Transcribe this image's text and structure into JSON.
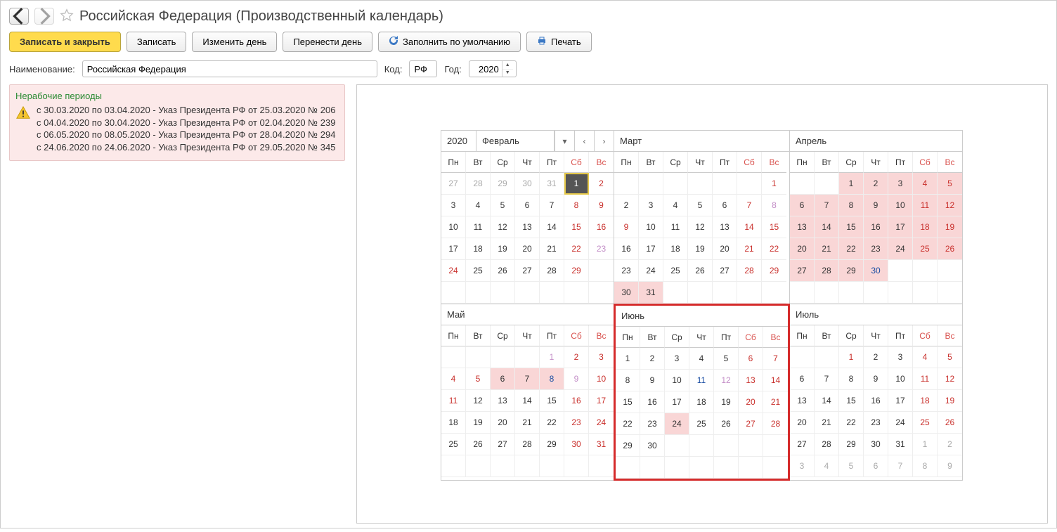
{
  "title": "Российская Федерация (Производственный календарь)",
  "toolbar": {
    "saveClose": "Записать и закрыть",
    "save": "Записать",
    "changeDay": "Изменить день",
    "moveDay": "Перенести день",
    "fillDefault": "Заполнить по умолчанию",
    "print": "Печать"
  },
  "form": {
    "nameLabel": "Наименование:",
    "nameValue": "Российская Федерация",
    "codeLabel": "Код:",
    "codeValue": "РФ",
    "yearLabel": "Год:",
    "yearValue": "2020"
  },
  "warning": {
    "title": "Нерабочие периоды",
    "items": [
      "с 30.03.2020 по 03.04.2020 - Указ Президента РФ от 25.03.2020 № 206",
      "с 04.04.2020 по 30.04.2020 - Указ Президента РФ от 02.04.2020 № 239",
      "с 06.05.2020 по 08.05.2020 - Указ Президента РФ от 28.04.2020 № 294",
      "с 24.06.2020 по 24.06.2020 - Указ Президента РФ от 29.05.2020 № 345"
    ]
  },
  "calendar": {
    "year": "2020",
    "dow": [
      "Пн",
      "Вт",
      "Ср",
      "Чт",
      "Пт",
      "Сб",
      "Вс"
    ],
    "months": [
      {
        "name": "Февраль",
        "hasYear": true,
        "hasNav": true,
        "weeks": [
          [
            {
              "n": "27",
              "cls": "muted"
            },
            {
              "n": "28",
              "cls": "muted"
            },
            {
              "n": "29",
              "cls": "muted"
            },
            {
              "n": "30",
              "cls": "muted"
            },
            {
              "n": "31",
              "cls": "muted"
            },
            {
              "n": "1",
              "cls": "sel"
            },
            {
              "n": "2",
              "cls": "red"
            }
          ],
          [
            {
              "n": "3"
            },
            {
              "n": "4"
            },
            {
              "n": "5"
            },
            {
              "n": "6"
            },
            {
              "n": "7"
            },
            {
              "n": "8",
              "cls": "red"
            },
            {
              "n": "9",
              "cls": "red"
            }
          ],
          [
            {
              "n": "10"
            },
            {
              "n": "11"
            },
            {
              "n": "12"
            },
            {
              "n": "13"
            },
            {
              "n": "14"
            },
            {
              "n": "15",
              "cls": "red"
            },
            {
              "n": "16",
              "cls": "red"
            }
          ],
          [
            {
              "n": "17"
            },
            {
              "n": "18"
            },
            {
              "n": "19"
            },
            {
              "n": "20"
            },
            {
              "n": "21"
            },
            {
              "n": "22",
              "cls": "red"
            },
            {
              "n": "23",
              "cls": "violet"
            }
          ],
          [
            {
              "n": "24",
              "cls": "red"
            },
            {
              "n": "25"
            },
            {
              "n": "26"
            },
            {
              "n": "27"
            },
            {
              "n": "28"
            },
            {
              "n": "29",
              "cls": "red"
            },
            {
              "n": ""
            }
          ],
          [
            {
              "n": ""
            },
            {
              "n": ""
            },
            {
              "n": ""
            },
            {
              "n": ""
            },
            {
              "n": ""
            },
            {
              "n": ""
            },
            {
              "n": ""
            }
          ]
        ]
      },
      {
        "name": "Март",
        "weeks": [
          [
            {
              "n": ""
            },
            {
              "n": ""
            },
            {
              "n": ""
            },
            {
              "n": ""
            },
            {
              "n": ""
            },
            {
              "n": ""
            },
            {
              "n": "1",
              "cls": "red"
            }
          ],
          [
            {
              "n": "2"
            },
            {
              "n": "3"
            },
            {
              "n": "4"
            },
            {
              "n": "5"
            },
            {
              "n": "6"
            },
            {
              "n": "7",
              "cls": "red"
            },
            {
              "n": "8",
              "cls": "violet"
            }
          ],
          [
            {
              "n": "9",
              "cls": "red"
            },
            {
              "n": "10"
            },
            {
              "n": "11"
            },
            {
              "n": "12"
            },
            {
              "n": "13"
            },
            {
              "n": "14",
              "cls": "red"
            },
            {
              "n": "15",
              "cls": "red"
            }
          ],
          [
            {
              "n": "16"
            },
            {
              "n": "17"
            },
            {
              "n": "18"
            },
            {
              "n": "19"
            },
            {
              "n": "20"
            },
            {
              "n": "21",
              "cls": "red"
            },
            {
              "n": "22",
              "cls": "red"
            }
          ],
          [
            {
              "n": "23"
            },
            {
              "n": "24"
            },
            {
              "n": "25"
            },
            {
              "n": "26"
            },
            {
              "n": "27"
            },
            {
              "n": "28",
              "cls": "red"
            },
            {
              "n": "29",
              "cls": "red"
            }
          ],
          [
            {
              "n": "30",
              "cls": "pink-bg"
            },
            {
              "n": "31",
              "cls": "pink-bg"
            },
            {
              "n": ""
            },
            {
              "n": ""
            },
            {
              "n": ""
            },
            {
              "n": ""
            },
            {
              "n": ""
            }
          ]
        ]
      },
      {
        "name": "Апрель",
        "weeks": [
          [
            {
              "n": ""
            },
            {
              "n": ""
            },
            {
              "n": "1",
              "cls": "pink-bg"
            },
            {
              "n": "2",
              "cls": "pink-bg"
            },
            {
              "n": "3",
              "cls": "pink-bg"
            },
            {
              "n": "4",
              "cls": "red pink-bg"
            },
            {
              "n": "5",
              "cls": "red pink-bg"
            }
          ],
          [
            {
              "n": "6",
              "cls": "pink-bg"
            },
            {
              "n": "7",
              "cls": "pink-bg"
            },
            {
              "n": "8",
              "cls": "pink-bg"
            },
            {
              "n": "9",
              "cls": "pink-bg"
            },
            {
              "n": "10",
              "cls": "pink-bg"
            },
            {
              "n": "11",
              "cls": "red pink-bg"
            },
            {
              "n": "12",
              "cls": "red pink-bg"
            }
          ],
          [
            {
              "n": "13",
              "cls": "pink-bg"
            },
            {
              "n": "14",
              "cls": "pink-bg"
            },
            {
              "n": "15",
              "cls": "pink-bg"
            },
            {
              "n": "16",
              "cls": "pink-bg"
            },
            {
              "n": "17",
              "cls": "pink-bg"
            },
            {
              "n": "18",
              "cls": "red pink-bg"
            },
            {
              "n": "19",
              "cls": "red pink-bg"
            }
          ],
          [
            {
              "n": "20",
              "cls": "pink-bg"
            },
            {
              "n": "21",
              "cls": "pink-bg"
            },
            {
              "n": "22",
              "cls": "pink-bg"
            },
            {
              "n": "23",
              "cls": "pink-bg"
            },
            {
              "n": "24",
              "cls": "pink-bg"
            },
            {
              "n": "25",
              "cls": "red pink-bg"
            },
            {
              "n": "26",
              "cls": "red pink-bg"
            }
          ],
          [
            {
              "n": "27",
              "cls": "pink-bg"
            },
            {
              "n": "28",
              "cls": "pink-bg"
            },
            {
              "n": "29",
              "cls": "pink-bg"
            },
            {
              "n": "30",
              "cls": "navy pink-bg"
            },
            {
              "n": ""
            },
            {
              "n": ""
            },
            {
              "n": ""
            }
          ],
          [
            {
              "n": ""
            },
            {
              "n": ""
            },
            {
              "n": ""
            },
            {
              "n": ""
            },
            {
              "n": ""
            },
            {
              "n": ""
            },
            {
              "n": ""
            }
          ]
        ]
      },
      {
        "name": "Май",
        "weeks": [
          [
            {
              "n": ""
            },
            {
              "n": ""
            },
            {
              "n": ""
            },
            {
              "n": ""
            },
            {
              "n": "1",
              "cls": "violet"
            },
            {
              "n": "2",
              "cls": "red"
            },
            {
              "n": "3",
              "cls": "red"
            }
          ],
          [
            {
              "n": "4",
              "cls": "red"
            },
            {
              "n": "5",
              "cls": "red"
            },
            {
              "n": "6",
              "cls": "pink-bg"
            },
            {
              "n": "7",
              "cls": "pink-bg"
            },
            {
              "n": "8",
              "cls": "navy pink-bg"
            },
            {
              "n": "9",
              "cls": "violet"
            },
            {
              "n": "10",
              "cls": "red"
            }
          ],
          [
            {
              "n": "11",
              "cls": "red"
            },
            {
              "n": "12"
            },
            {
              "n": "13"
            },
            {
              "n": "14"
            },
            {
              "n": "15"
            },
            {
              "n": "16",
              "cls": "red"
            },
            {
              "n": "17",
              "cls": "red"
            }
          ],
          [
            {
              "n": "18"
            },
            {
              "n": "19"
            },
            {
              "n": "20"
            },
            {
              "n": "21"
            },
            {
              "n": "22"
            },
            {
              "n": "23",
              "cls": "red"
            },
            {
              "n": "24",
              "cls": "red"
            }
          ],
          [
            {
              "n": "25"
            },
            {
              "n": "26"
            },
            {
              "n": "27"
            },
            {
              "n": "28"
            },
            {
              "n": "29"
            },
            {
              "n": "30",
              "cls": "red"
            },
            {
              "n": "31",
              "cls": "red"
            }
          ],
          [
            {
              "n": ""
            },
            {
              "n": ""
            },
            {
              "n": ""
            },
            {
              "n": ""
            },
            {
              "n": ""
            },
            {
              "n": ""
            },
            {
              "n": ""
            }
          ]
        ]
      },
      {
        "name": "Июнь",
        "highlight": true,
        "weeks": [
          [
            {
              "n": "1"
            },
            {
              "n": "2"
            },
            {
              "n": "3"
            },
            {
              "n": "4"
            },
            {
              "n": "5"
            },
            {
              "n": "6",
              "cls": "red"
            },
            {
              "n": "7",
              "cls": "red"
            }
          ],
          [
            {
              "n": "8"
            },
            {
              "n": "9"
            },
            {
              "n": "10"
            },
            {
              "n": "11",
              "cls": "navy"
            },
            {
              "n": "12",
              "cls": "violet"
            },
            {
              "n": "13",
              "cls": "red"
            },
            {
              "n": "14",
              "cls": "red"
            }
          ],
          [
            {
              "n": "15"
            },
            {
              "n": "16"
            },
            {
              "n": "17"
            },
            {
              "n": "18"
            },
            {
              "n": "19"
            },
            {
              "n": "20",
              "cls": "red"
            },
            {
              "n": "21",
              "cls": "red"
            }
          ],
          [
            {
              "n": "22"
            },
            {
              "n": "23"
            },
            {
              "n": "24",
              "cls": "pink-bg"
            },
            {
              "n": "25"
            },
            {
              "n": "26"
            },
            {
              "n": "27",
              "cls": "red"
            },
            {
              "n": "28",
              "cls": "red"
            }
          ],
          [
            {
              "n": "29"
            },
            {
              "n": "30"
            },
            {
              "n": ""
            },
            {
              "n": ""
            },
            {
              "n": ""
            },
            {
              "n": ""
            },
            {
              "n": ""
            }
          ],
          [
            {
              "n": ""
            },
            {
              "n": ""
            },
            {
              "n": ""
            },
            {
              "n": ""
            },
            {
              "n": ""
            },
            {
              "n": ""
            },
            {
              "n": ""
            }
          ]
        ]
      },
      {
        "name": "Июль",
        "weeks": [
          [
            {
              "n": ""
            },
            {
              "n": ""
            },
            {
              "n": "1",
              "cls": "red"
            },
            {
              "n": "2"
            },
            {
              "n": "3"
            },
            {
              "n": "4",
              "cls": "red"
            },
            {
              "n": "5",
              "cls": "red"
            }
          ],
          [
            {
              "n": "6"
            },
            {
              "n": "7"
            },
            {
              "n": "8"
            },
            {
              "n": "9"
            },
            {
              "n": "10"
            },
            {
              "n": "11",
              "cls": "red"
            },
            {
              "n": "12",
              "cls": "red"
            }
          ],
          [
            {
              "n": "13"
            },
            {
              "n": "14"
            },
            {
              "n": "15"
            },
            {
              "n": "16"
            },
            {
              "n": "17"
            },
            {
              "n": "18",
              "cls": "red"
            },
            {
              "n": "19",
              "cls": "red"
            }
          ],
          [
            {
              "n": "20"
            },
            {
              "n": "21"
            },
            {
              "n": "22"
            },
            {
              "n": "23"
            },
            {
              "n": "24"
            },
            {
              "n": "25",
              "cls": "red"
            },
            {
              "n": "26",
              "cls": "red"
            }
          ],
          [
            {
              "n": "27"
            },
            {
              "n": "28"
            },
            {
              "n": "29"
            },
            {
              "n": "30"
            },
            {
              "n": "31"
            },
            {
              "n": "1",
              "cls": "muted"
            },
            {
              "n": "2",
              "cls": "muted"
            }
          ],
          [
            {
              "n": "3",
              "cls": "muted"
            },
            {
              "n": "4",
              "cls": "muted"
            },
            {
              "n": "5",
              "cls": "muted"
            },
            {
              "n": "6",
              "cls": "muted"
            },
            {
              "n": "7",
              "cls": "muted"
            },
            {
              "n": "8",
              "cls": "muted"
            },
            {
              "n": "9",
              "cls": "muted"
            }
          ]
        ]
      }
    ]
  }
}
